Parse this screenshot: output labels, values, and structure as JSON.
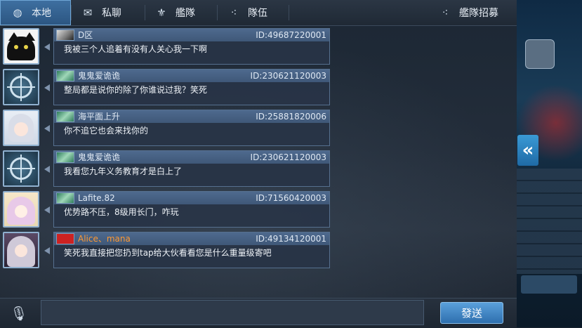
{
  "tabs": [
    {
      "label": "本地",
      "icon": "globe-icon",
      "active": true
    },
    {
      "label": "私聊",
      "icon": "chat-bubble-icon",
      "active": false
    },
    {
      "label": "艦隊",
      "icon": "fleet-emblem-icon",
      "active": false
    },
    {
      "label": "隊伍",
      "icon": "team-dots-icon",
      "active": false
    },
    {
      "label": "艦隊招募",
      "icon": "recruit-dots-icon",
      "active": false
    }
  ],
  "messages": [
    {
      "name": "D区",
      "uid": "ID:49687220001",
      "text": "我被三个人追着有没有人关心我一下啊",
      "avatar": "black-cat",
      "flag": "gray"
    },
    {
      "name": "鬼鬼爱诡诡",
      "uid": "ID:230621120003",
      "text": "整局都是说你的除了你谁说过我？笑死",
      "avatar": "dial",
      "flag": "green"
    },
    {
      "name": "海平面上升",
      "uid": "ID:25881820006",
      "text": "你不追它也会来找你的",
      "avatar": "girl-white-hair",
      "flag": "green"
    },
    {
      "name": "鬼鬼爱诡诡",
      "uid": "ID:230621120003",
      "text": "我看您九年义务教育才是白上了",
      "avatar": "dial",
      "flag": "green"
    },
    {
      "name": "Lafite.82",
      "uid": "ID:71560420003",
      "text": "优势路不压，8级用长门，咋玩",
      "avatar": "girl-pink-hair",
      "flag": "green"
    },
    {
      "name": "Alice、mana",
      "uid": "ID:49134120001",
      "text": "笑死我直接把您扔到tap给大伙看看您是什么重量级寄吧",
      "avatar": "girl-dark",
      "flag": "red",
      "name_color": "#ff9933"
    }
  ],
  "input": {
    "value": "",
    "placeholder": ""
  },
  "send_label": "發送",
  "icons": {
    "mic": "microphone-icon",
    "collapse": "double-chevron-left-icon"
  },
  "colors": {
    "accent": "#3e6fa0",
    "send": "#2e6fae",
    "highlight_name": "#ff9933"
  }
}
